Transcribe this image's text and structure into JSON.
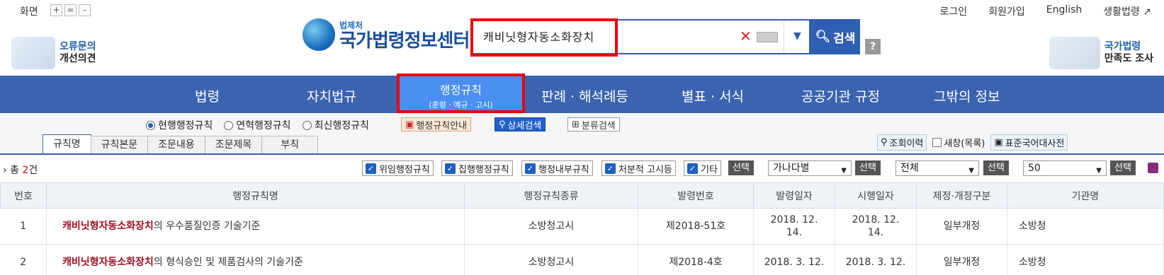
{
  "topbar": {
    "zoom_label": "화면",
    "zoom_plus": "+",
    "zoom_reset": "=",
    "zoom_minus": "-",
    "links": [
      "로그인",
      "회원가입",
      "English",
      "생활법령"
    ]
  },
  "logo": {
    "small": "법제처",
    "big": "국가법령정보센터"
  },
  "promo_left": {
    "line1": "오류문의",
    "line2": "개선의견"
  },
  "promo_right": {
    "line1": "국가법령",
    "line2": "만족도 조사"
  },
  "search": {
    "value": "캐비닛형자동소화장치",
    "button": "검색",
    "help": "?"
  },
  "nav": {
    "items": [
      "법령",
      "자치법규",
      "판례 · 해석례등",
      "별표 · 서식",
      "공공기관 규정",
      "그밖의 정보"
    ],
    "active": {
      "title": "행정규칙",
      "sub": "(훈령 · 예규 · 고시)"
    }
  },
  "radios": [
    {
      "label": "현행행정규칙",
      "checked": true
    },
    {
      "label": "연혁행정규칙",
      "checked": false
    },
    {
      "label": "최신행정규칙",
      "checked": false
    }
  ],
  "buttons": {
    "guide": "행정규칙안내",
    "detail": "상세검색",
    "category": "분류검색"
  },
  "tabs": [
    "규칙명",
    "규칙본문",
    "조문내용",
    "조문제목",
    "부칙"
  ],
  "rlinks": {
    "history": "조회이력",
    "newwin": "새창(목록)",
    "dict": "표준국어대사전"
  },
  "filter": {
    "total_prefix": "총",
    "total_count": "2",
    "total_suffix": "건",
    "checks": [
      "위임행정규칙",
      "집행행정규칙",
      "행정내부규칙",
      "처분적 고시등",
      "기타"
    ],
    "select_btn": "선택",
    "sort": "가나다별",
    "scope": "전체",
    "page_size": "50"
  },
  "table": {
    "headers": [
      "번호",
      "행정규칙명",
      "행정규칙종류",
      "발령번호",
      "발령일자",
      "시행일자",
      "제정·개정구분",
      "기관명"
    ],
    "rows": [
      {
        "no": "1",
        "name_hl": "캐비닛형자동소화장치",
        "name_rest": "의 우수품질인증 기술기준",
        "kind": "소방청고시",
        "num": "제2018-51호",
        "issue": "2018. 12. 14.",
        "effect": "2018. 12. 14.",
        "type": "일부개정",
        "org": "소방청"
      },
      {
        "no": "2",
        "name_hl": "캐비닛형자동소화장치",
        "name_rest": "의 형식승인 및 제품검사의 기술기준",
        "kind": "소방청고시",
        "num": "제2018-4호",
        "issue": "2018. 3. 12.",
        "effect": "2018. 3. 12.",
        "type": "일부개정",
        "org": "소방청"
      }
    ]
  }
}
